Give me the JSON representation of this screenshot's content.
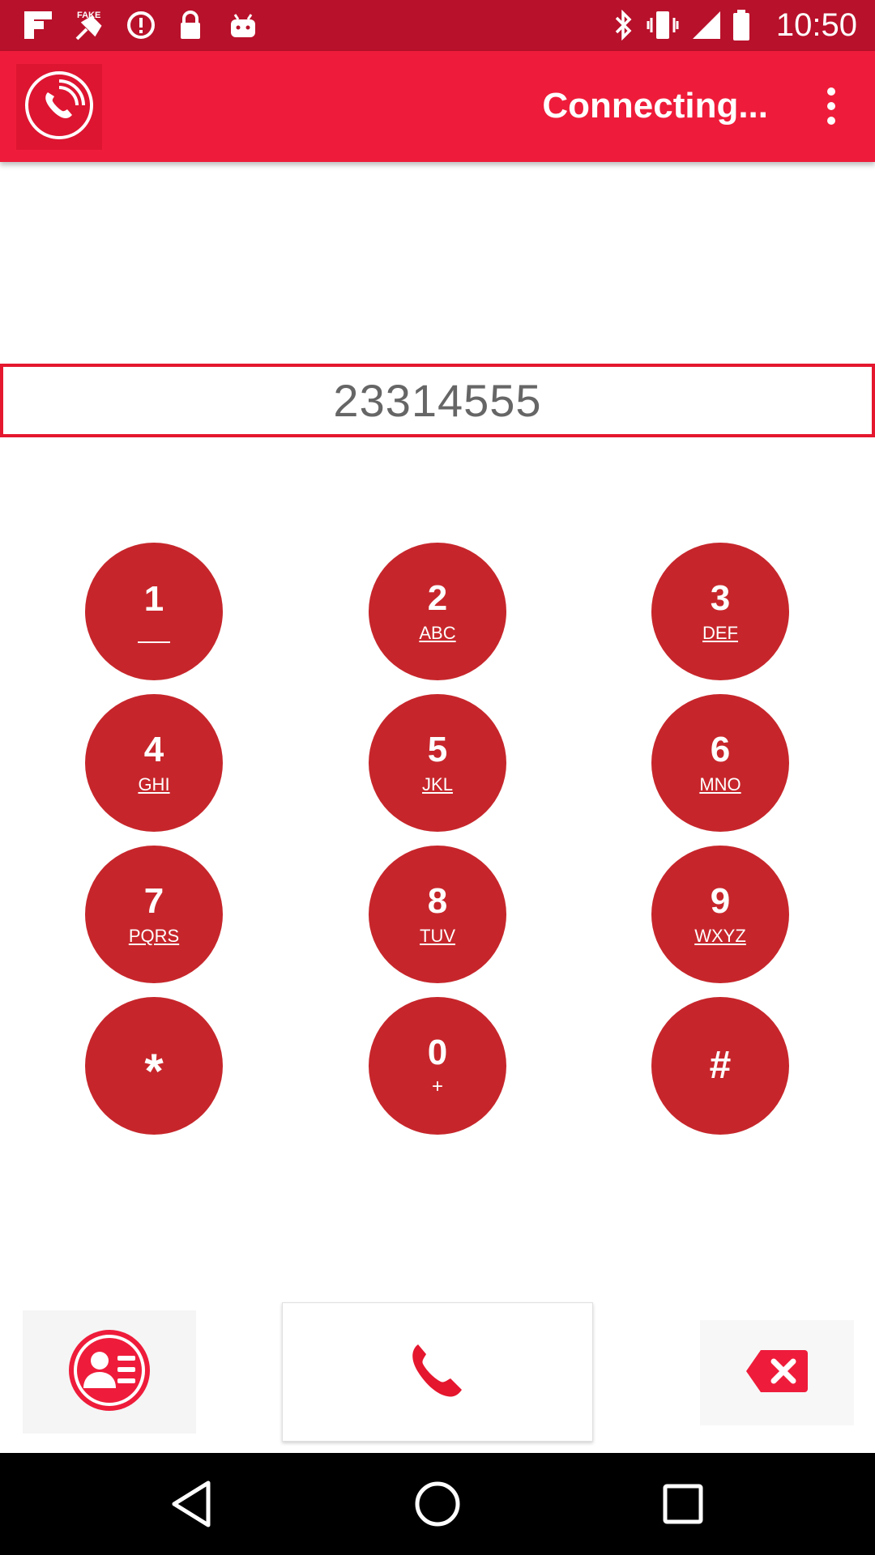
{
  "status_bar": {
    "time": "10:50",
    "icons": [
      "flipboard-icon",
      "fake-gps-icon",
      "info-icon",
      "lock-icon",
      "android-icon",
      "bluetooth-icon",
      "vibrate-icon",
      "signal-icon",
      "battery-icon"
    ]
  },
  "app_bar": {
    "title": "Connecting...",
    "logo_icon": "phone-ring-icon",
    "menu_icon": "more-vert-icon"
  },
  "dialer": {
    "number": "23314555"
  },
  "keypad": {
    "keys": [
      {
        "digit": "1",
        "letters": ""
      },
      {
        "digit": "2",
        "letters": "ABC"
      },
      {
        "digit": "3",
        "letters": "DEF"
      },
      {
        "digit": "4",
        "letters": "GHI"
      },
      {
        "digit": "5",
        "letters": "JKL"
      },
      {
        "digit": "6",
        "letters": "MNO"
      },
      {
        "digit": "7",
        "letters": "PQRS"
      },
      {
        "digit": "8",
        "letters": "TUV"
      },
      {
        "digit": "9",
        "letters": "WXYZ"
      },
      {
        "digit": "*",
        "letters": ""
      },
      {
        "digit": "0",
        "letters": "+"
      },
      {
        "digit": "#",
        "letters": ""
      }
    ]
  },
  "bottom_controls": {
    "contacts_icon": "contacts-icon",
    "call_icon": "call-icon",
    "delete_icon": "backspace-icon"
  },
  "nav_bar": {
    "buttons": [
      "back-icon",
      "home-icon",
      "recents-icon"
    ]
  },
  "colors": {
    "status_bar": "#b8112b",
    "app_bar": "#ee1c3a",
    "key": "#c6262b",
    "accent": "#e4172e"
  }
}
